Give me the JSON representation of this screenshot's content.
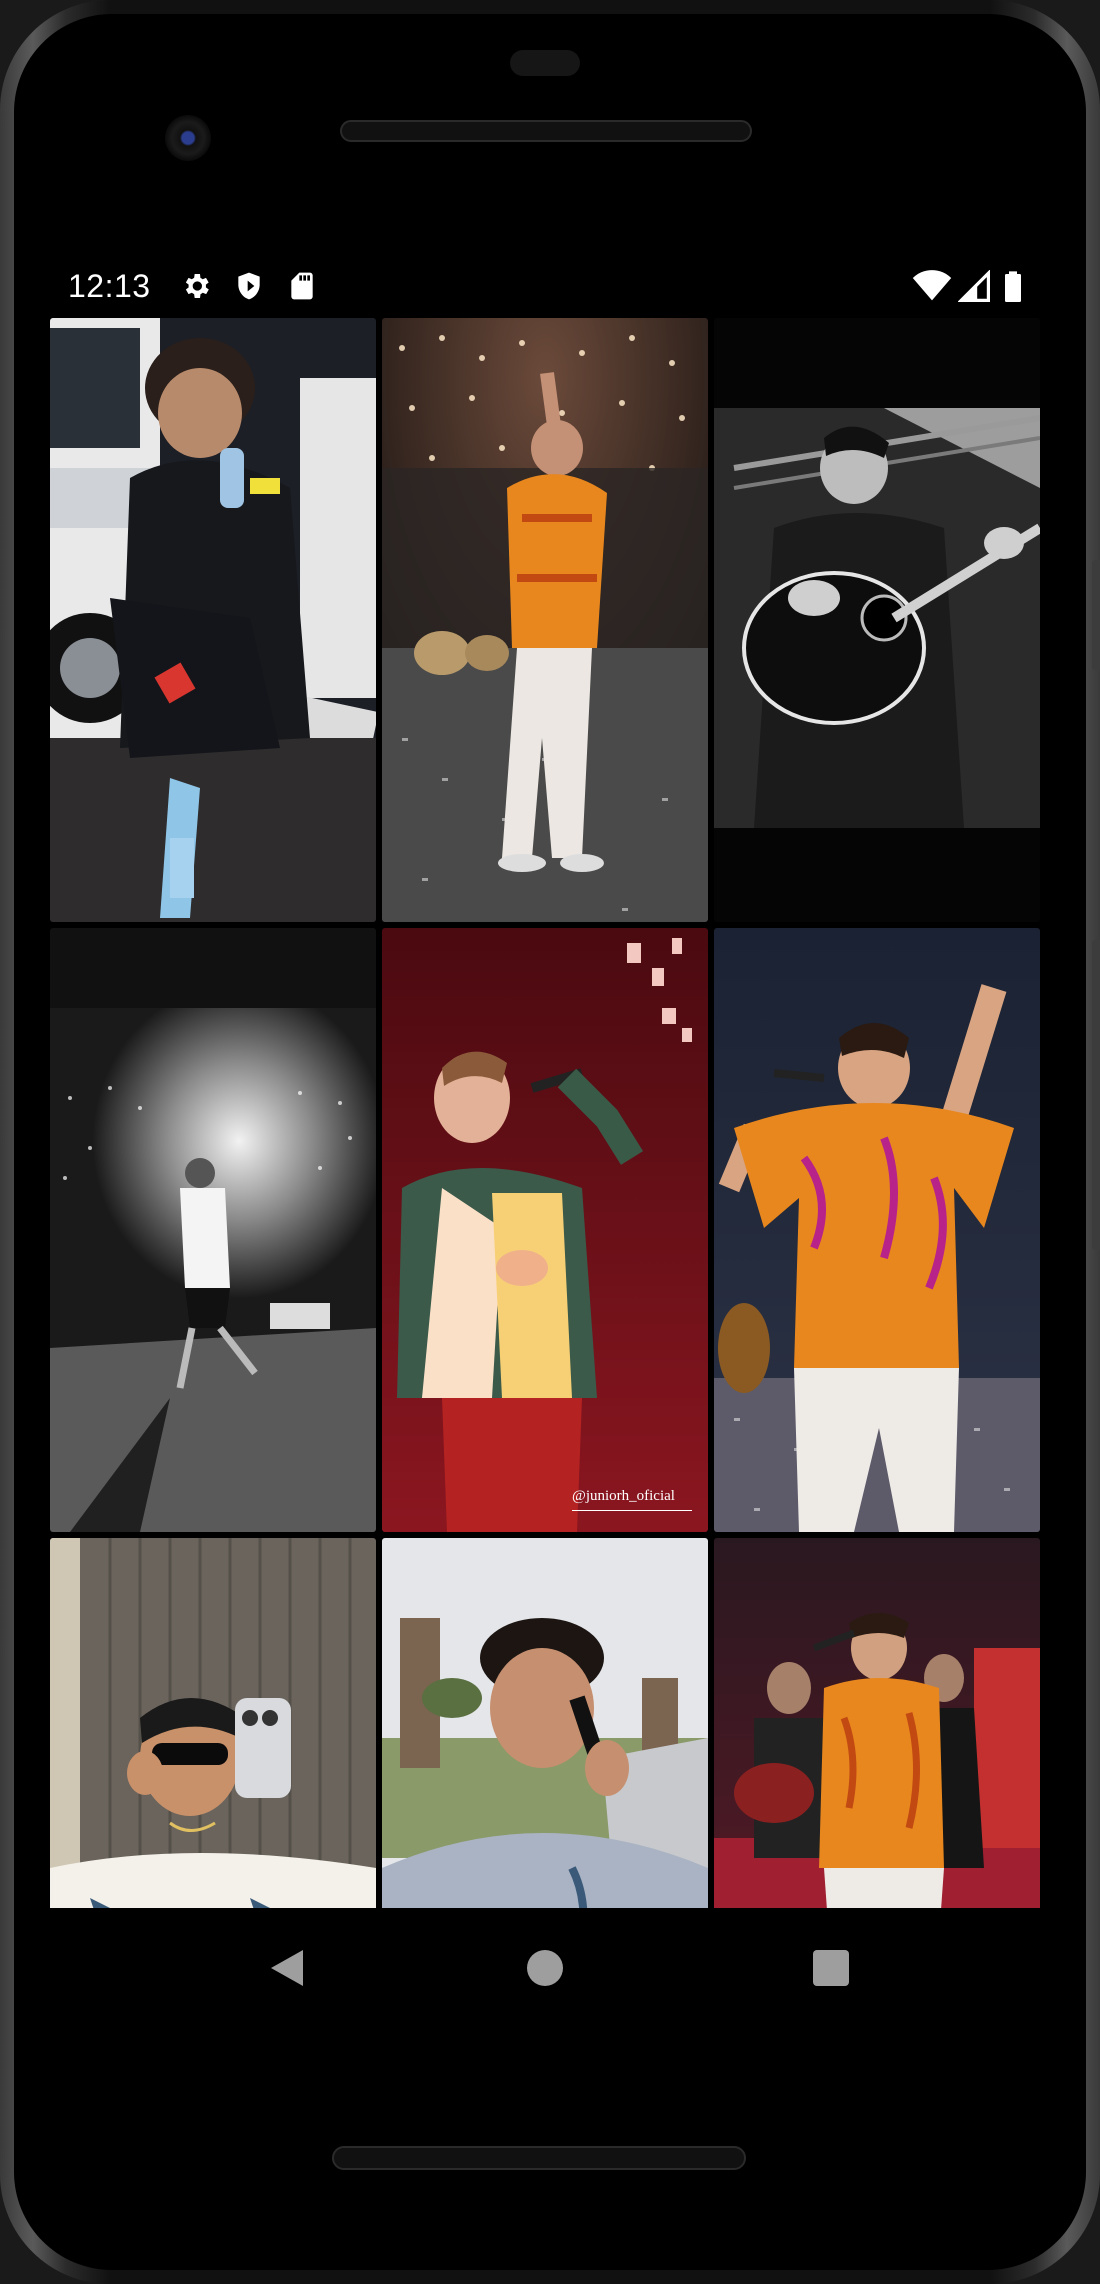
{
  "status_bar": {
    "time": "12:13",
    "left_icons": [
      "settings-icon",
      "shield-icon",
      "sd-card-icon"
    ],
    "right_icons": [
      "wifi-icon",
      "cell-signal-icon",
      "battery-icon"
    ]
  },
  "gallery": {
    "tiles": [
      {
        "name": "photo-tile-1",
        "subject": "man sitting in white vehicle drinking from bottle"
      },
      {
        "name": "photo-tile-2",
        "subject": "singer in orange shirt on stage with crowd lights"
      },
      {
        "name": "photo-tile-3",
        "subject": "black and white singer with acoustic guitar"
      },
      {
        "name": "photo-tile-4",
        "subject": "black and white singer on stage spotlight"
      },
      {
        "name": "photo-tile-5",
        "subject": "singer in green jacket under red light",
        "watermark": "@juniorh_oficial"
      },
      {
        "name": "photo-tile-6",
        "subject": "singer in orange shirt raising arm"
      },
      {
        "name": "photo-tile-7",
        "subject": "mirror selfie with sunglasses"
      },
      {
        "name": "photo-tile-8",
        "subject": "man in grey sweater on phone"
      },
      {
        "name": "photo-tile-9",
        "subject": "singer in orange shirt with band"
      }
    ]
  },
  "nav_bar": {
    "buttons": [
      "back-icon",
      "home-icon",
      "recents-icon"
    ]
  },
  "colors": {
    "background": "#000000",
    "orange_shirt": "#e8871e",
    "red_stage": "#7a1018"
  }
}
